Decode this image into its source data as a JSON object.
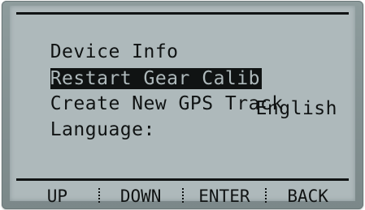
{
  "menu": {
    "items": [
      {
        "label": "Device Info"
      },
      {
        "label": "Restart Gear Calib",
        "selected": true
      },
      {
        "label": "Create New GPS Track"
      },
      {
        "label": "Language:",
        "value": "English"
      }
    ]
  },
  "softkeys": {
    "up": "UP",
    "down": "DOWN",
    "enter": "ENTER",
    "back": "BACK"
  },
  "colors": {
    "lcd_background": "#aeb9bb",
    "lcd_ink": "#101313",
    "bezel": "#8e9c9d"
  }
}
